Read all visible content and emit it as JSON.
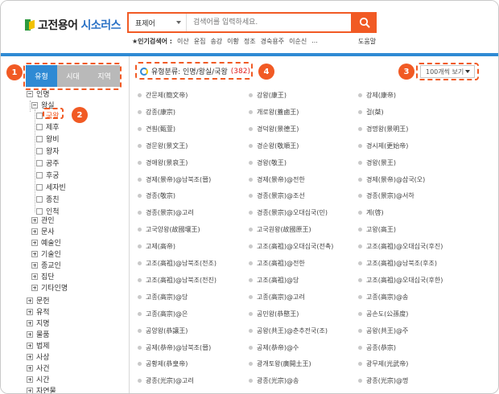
{
  "header": {
    "logo_part1": "고전용어",
    "logo_part2": "시소러스",
    "search": {
      "select_value": "표제어",
      "placeholder": "검색어를 입력하세요."
    },
    "popular": {
      "star": "★",
      "label": "인기검색어 :",
      "keywords": [
        "이산",
        "윤집",
        "송강",
        "이황",
        "정조",
        "경숙용주",
        "이순신",
        "..."
      ]
    },
    "help_label": "도움말"
  },
  "tabs": [
    "유형",
    "시대",
    "지역"
  ],
  "badges": [
    "1",
    "2",
    "3",
    "4"
  ],
  "tree": {
    "root": "인명",
    "sub": "왕실",
    "leaves": [
      "국왕",
      "제후",
      "왕비",
      "왕자",
      "공주",
      "후궁",
      "세자빈",
      "종친",
      "인척"
    ],
    "siblings": [
      "관인",
      "문사",
      "예술인",
      "기술인",
      "종교인",
      "집단",
      "기타인명"
    ],
    "top": [
      "문헌",
      "유적",
      "지명",
      "물품",
      "법제",
      "사상",
      "사건",
      "시간",
      "자연물"
    ]
  },
  "category": {
    "label": "유형분류: 인명/왕실/국왕",
    "count": "(382)"
  },
  "per_page": "100개씩 보기",
  "results": [
    [
      "간문제(簡文帝)",
      "강왕(康王)",
      "강제(康帝)"
    ],
    [
      "강종(康宗)",
      "개로왕(蓋鹵王)",
      "걸(桀)"
    ],
    [
      "견훤(甄萱)",
      "경덕왕(景德王)",
      "경명왕(景明王)"
    ],
    [
      "경문왕(景文王)",
      "경순왕(敬順王)",
      "경시제(更始帝)"
    ],
    [
      "경애왕(景哀王)",
      "경왕(敬王)",
      "경왕(景王)"
    ],
    [
      "경제(景帝)@남북조(晉)",
      "경제(景帝)@전한",
      "경제(景帝)@삼국(오)"
    ],
    [
      "경종(敬宗)",
      "경종(景宗)@조선",
      "경종(景宗)@서하"
    ],
    [
      "경종(景宗)@고려",
      "경종(景宗)@오대십국(민)",
      "계(啓)"
    ],
    [
      "고국양왕(故國壤王)",
      "고국원왕(故國原王)",
      "고왕(高王)"
    ],
    [
      "고제(高帝)",
      "고조(高祖)@오대십국(전촉)",
      "고조(高祖)@오대십국(후진)"
    ],
    [
      "고조(高祖)@남북조(전조)",
      "고조(高祖)@전한",
      "고조(高祖)@남북조(후조)"
    ],
    [
      "고조(高祖)@남북조(전진)",
      "고조(高祖)@당",
      "고조(高祖)@오대십국(후한)"
    ],
    [
      "고종(高宗)@당",
      "고종(高宗)@고려",
      "고종(高宗)@송"
    ],
    [
      "고종(高宗)@은",
      "공민왕(恭愍王)",
      "공손도(公孫度)"
    ],
    [
      "공양왕(恭讓王)",
      "공왕(共王)@춘추전국(조)",
      "공왕(共王)@주"
    ],
    [
      "공제(恭帝)@남북조(晉)",
      "공제(恭帝)@수",
      "공종(恭宗)"
    ],
    [
      "공황제(恭皇帝)",
      "광개토왕(廣開土王)",
      "광무제(光武帝)"
    ],
    [
      "광종(光宗)@고려",
      "광종(光宗)@송",
      "광종(光宗)@명"
    ]
  ],
  "colors": {
    "accent_orange": "#f15a24",
    "header_blue": "#2f8ad4",
    "tab_inactive": "#b9b9b9",
    "count_red": "#e02020"
  }
}
